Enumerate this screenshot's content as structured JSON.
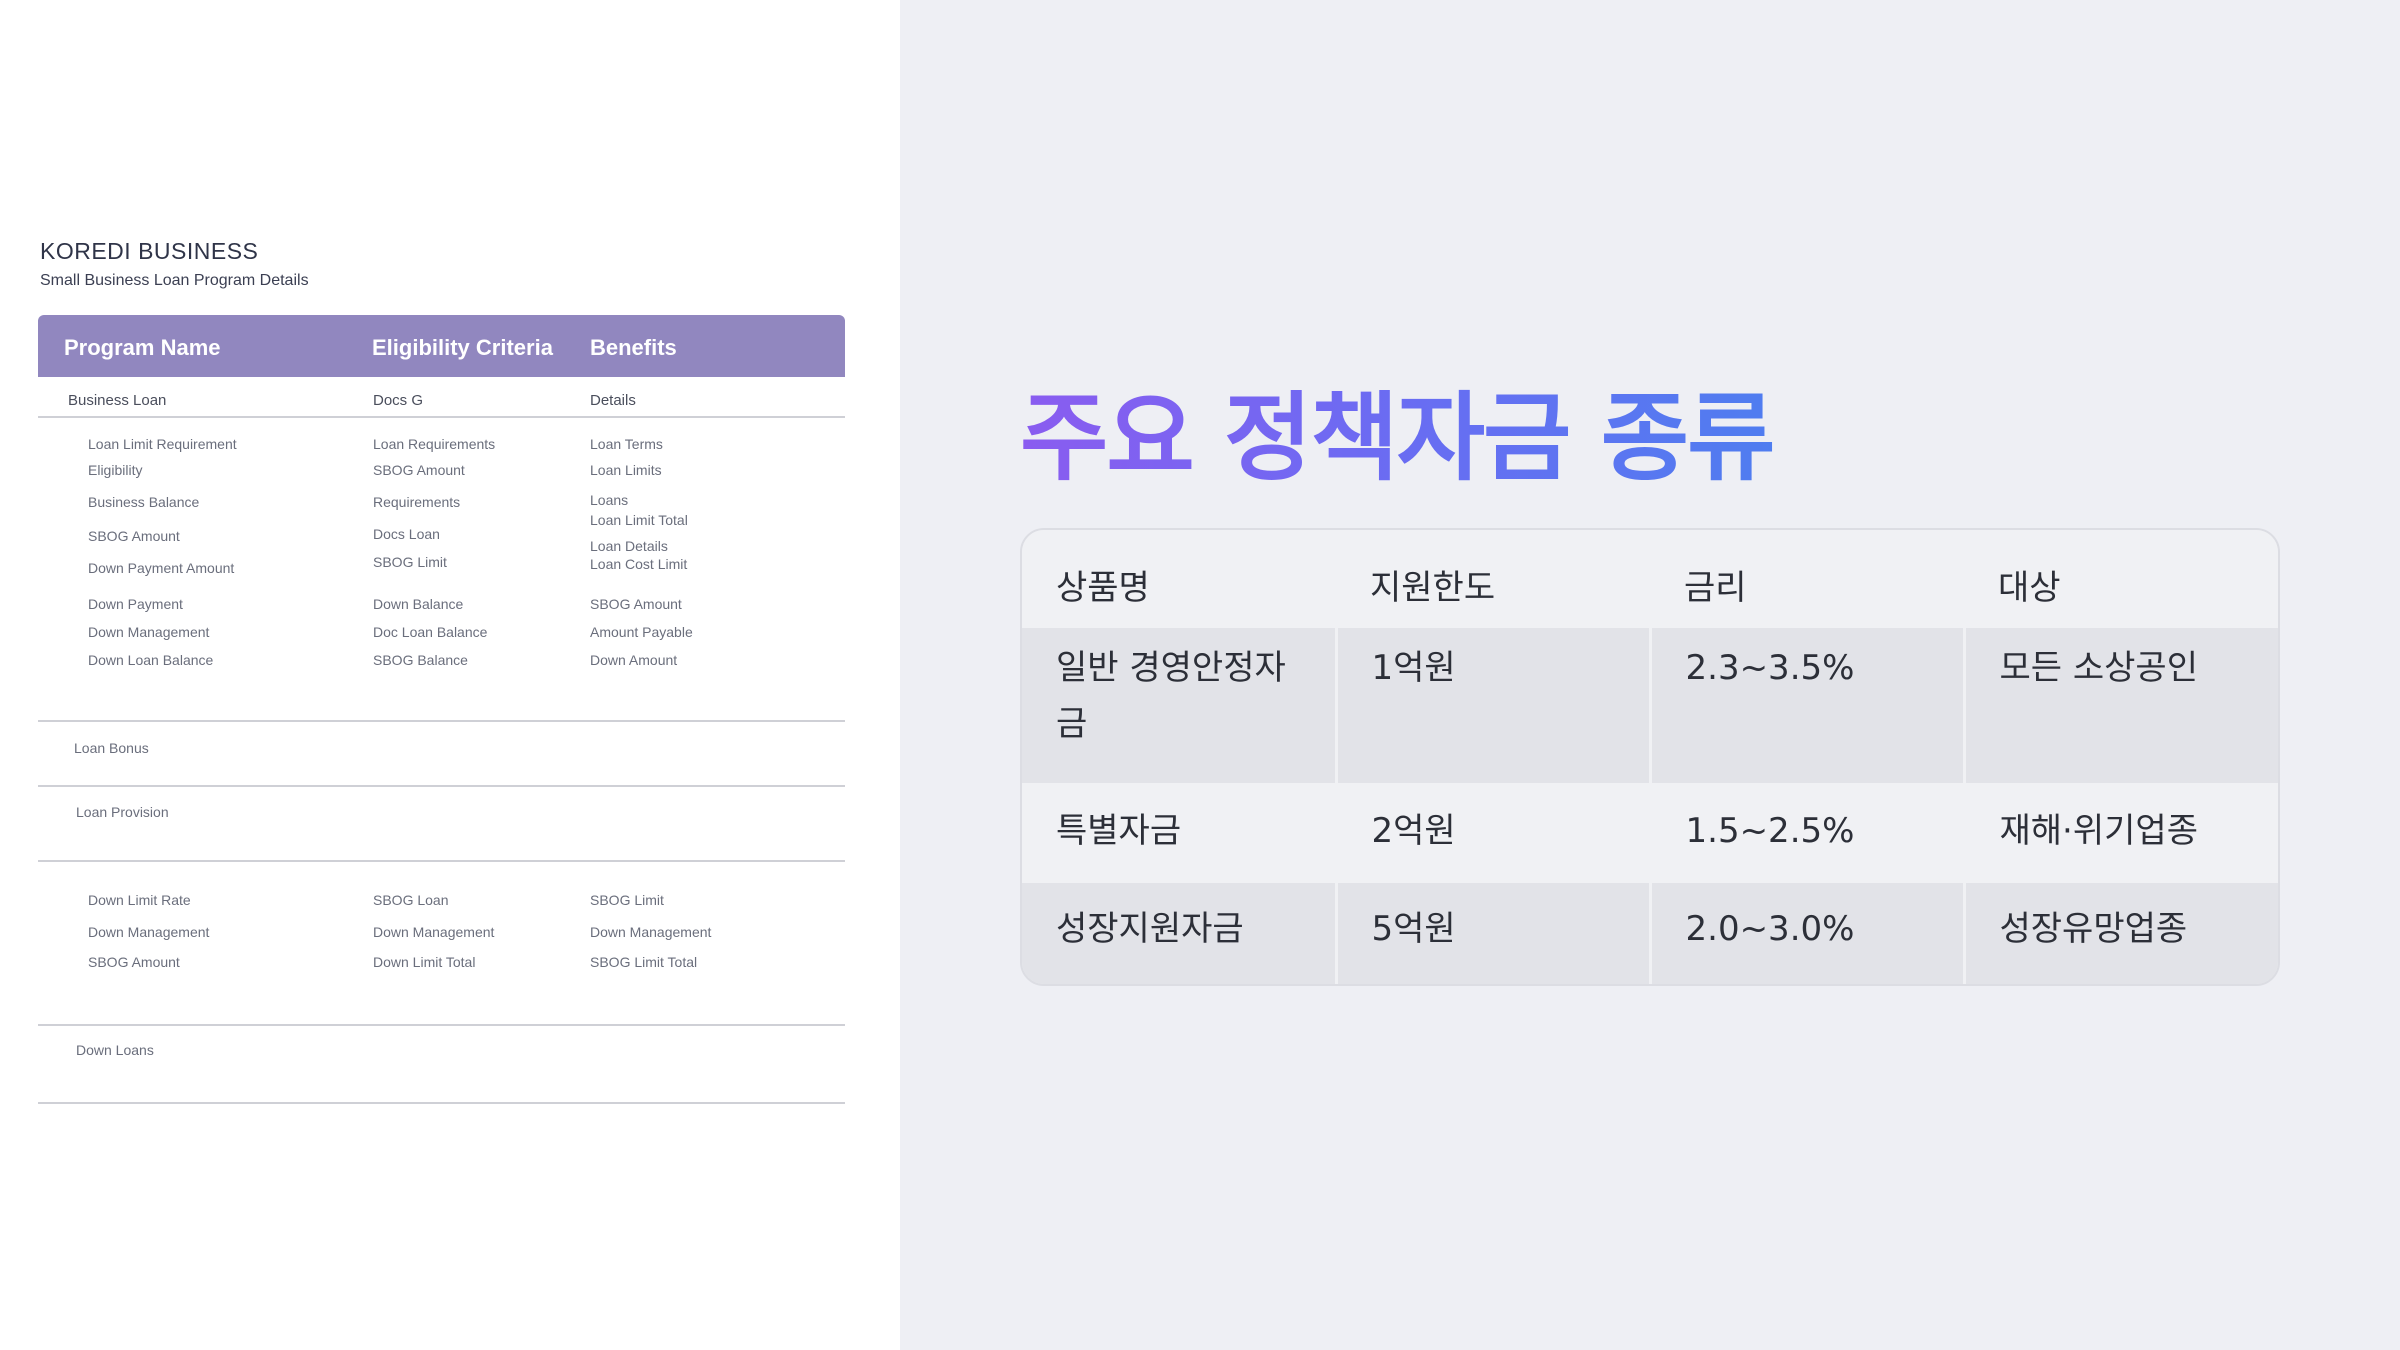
{
  "document": {
    "title": "KOREDI BUSINESS",
    "subtitle": "Small Business Loan Program Details",
    "headers": [
      "Program Name",
      "Eligibility Criteria",
      "Benefits"
    ],
    "subheader": [
      "Business Loan",
      "Docs G",
      "Details"
    ],
    "lines": [
      [
        "Loan Limit Requirement",
        "Loan Requirements",
        "Loan Terms"
      ],
      [
        "Eligibility",
        "SBOG Amount",
        "Loan Limits"
      ],
      [
        "Business Balance",
        "Requirements",
        "Loans"
      ],
      [
        "",
        "",
        "Loan Limit Total"
      ],
      [
        "SBOG Amount",
        "Docs Loan",
        ""
      ],
      [
        "",
        "",
        "Loan Details"
      ],
      [
        "Down Payment Amount",
        "SBOG Limit",
        "Loan Cost Limit"
      ],
      [
        "Down Payment",
        "Down Balance",
        "SBOG Amount"
      ],
      [
        "Down Management",
        "Doc Loan Balance",
        "Amount Payable"
      ],
      [
        "Down Loan Balance",
        "SBOG Balance",
        "Down Amount"
      ],
      [
        "Loan Bonus",
        "",
        ""
      ],
      [
        "Loan Provision",
        "",
        ""
      ],
      [
        "Down Limit Rate",
        "SBOG Loan",
        "SBOG Limit"
      ],
      [
        "Down Management",
        "Down Management",
        "Down Management"
      ],
      [
        "SBOG Amount",
        "Down Limit Total",
        "SBOG Limit Total"
      ],
      [
        "Down Loans",
        "",
        ""
      ]
    ]
  },
  "slide": {
    "title": "주요 정책자금 종류",
    "table": {
      "headers": [
        "상품명",
        "지원한도",
        "금리",
        "대상"
      ],
      "rows": [
        [
          "일반 경영안정자금",
          "1억원",
          "2.3~3.5%",
          "모든 소상공인"
        ],
        [
          "특별자금",
          "2억원",
          "1.5~2.5%",
          "재해·위기업종"
        ],
        [
          "성장지원자금",
          "5억원",
          "2.0~3.0%",
          "성장유망업종"
        ]
      ]
    }
  }
}
